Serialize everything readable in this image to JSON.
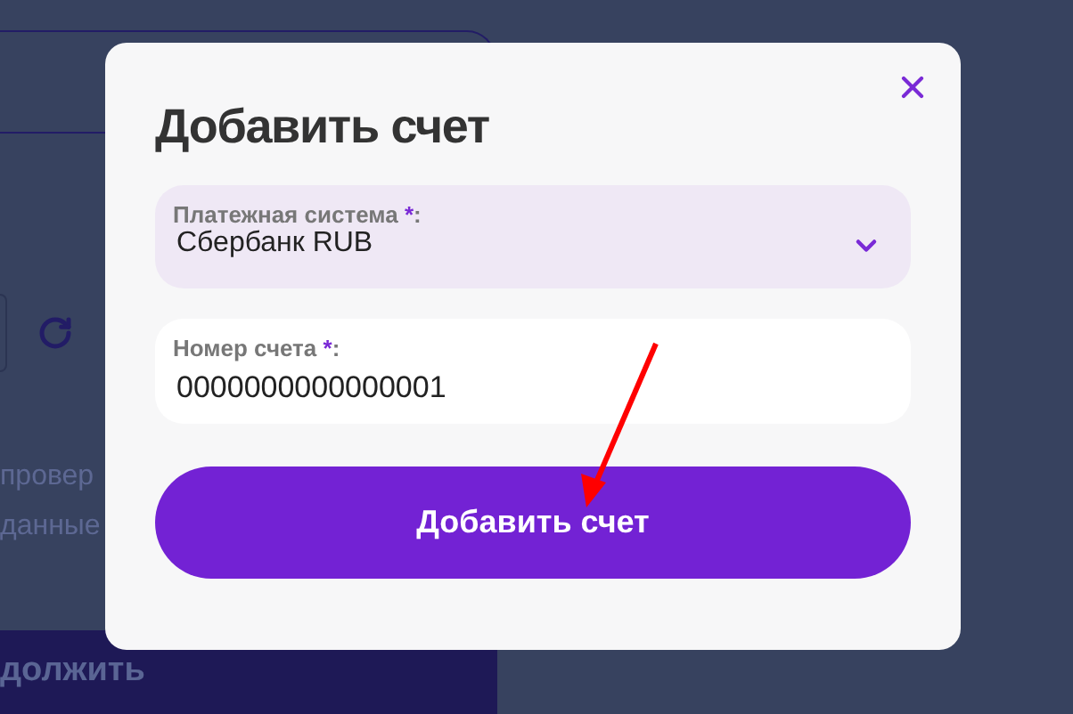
{
  "background": {
    "texts": [
      "провер",
      "данные"
    ],
    "continue_button": "должить"
  },
  "modal": {
    "title": "Добавить счет",
    "fields": [
      {
        "kind": "select",
        "label": "Платежная система",
        "required_mark": "*",
        "label_end": ":",
        "value": "Сбербанк RUB"
      },
      {
        "kind": "input",
        "label": "Номер счета",
        "required_mark": "*",
        "label_end": ":",
        "value": "0000000000000001"
      }
    ],
    "submit": "Добавить счет"
  }
}
